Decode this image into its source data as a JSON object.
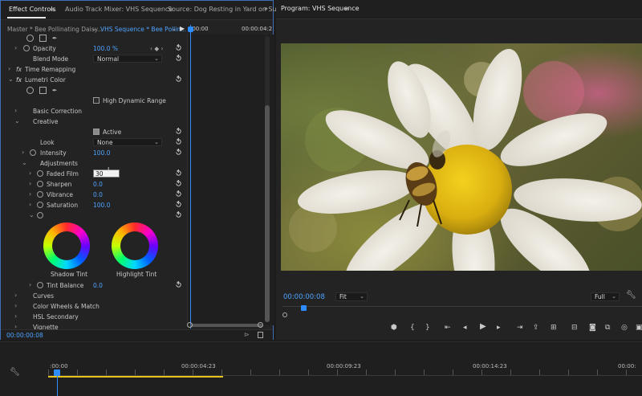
{
  "effect_controls": {
    "tabs": [
      "Effect Controls",
      "Audio Track Mixer: VHS Sequence",
      "Source: Dog Resting in Yard on Sunr"
    ],
    "overflow": "»",
    "master_label": "Master * Bee Pollinating Daisy...",
    "sequence_label": "VHS Sequence * Bee Pollin...",
    "timecode_left": ":00:00",
    "timecode_right": "00:00:04:2",
    "opacity": {
      "label": "Opacity",
      "value": "100.0 %"
    },
    "blend_mode": {
      "label": "Blend Mode",
      "value": "Normal"
    },
    "time_remapping": "Time Remapping",
    "lumetri": "Lumetri Color",
    "hdr": "High Dynamic Range",
    "basic_correction": "Basic Correction",
    "creative": "Creative",
    "active": "Active",
    "look": {
      "label": "Look",
      "value": "None"
    },
    "intensity": {
      "label": "Intensity",
      "value": "100.0"
    },
    "adjustments": "Adjustments",
    "faded_film": {
      "label": "Faded Film",
      "value": "30"
    },
    "sharpen": {
      "label": "Sharpen",
      "value": "0.0"
    },
    "vibrance": {
      "label": "Vibrance",
      "value": "0.0"
    },
    "saturation": {
      "label": "Saturation",
      "value": "100.0"
    },
    "shadow_tint": "Shadow Tint",
    "highlight_tint": "Highlight Tint",
    "tint_balance": {
      "label": "Tint Balance",
      "value": "0.0"
    },
    "curves": "Curves",
    "color_wheels": "Color Wheels & Match",
    "hsl": "HSL Secondary",
    "vignette": "Vignette",
    "current_time": "00:00:00:08",
    "fx": "fx"
  },
  "program": {
    "title": "Program: VHS Sequence",
    "timecode": "00:00:00:08",
    "zoom": "Fit",
    "resolution": "Full"
  },
  "timeline": {
    "ticks": [
      ":00:00",
      "00:00:04:23",
      "00:00:09:23",
      "00:00:14:23",
      "00:00:"
    ]
  },
  "colors": {
    "accent": "#4ea3ff",
    "playhead": "#2d8cff",
    "work_area": "#e6c21a"
  }
}
